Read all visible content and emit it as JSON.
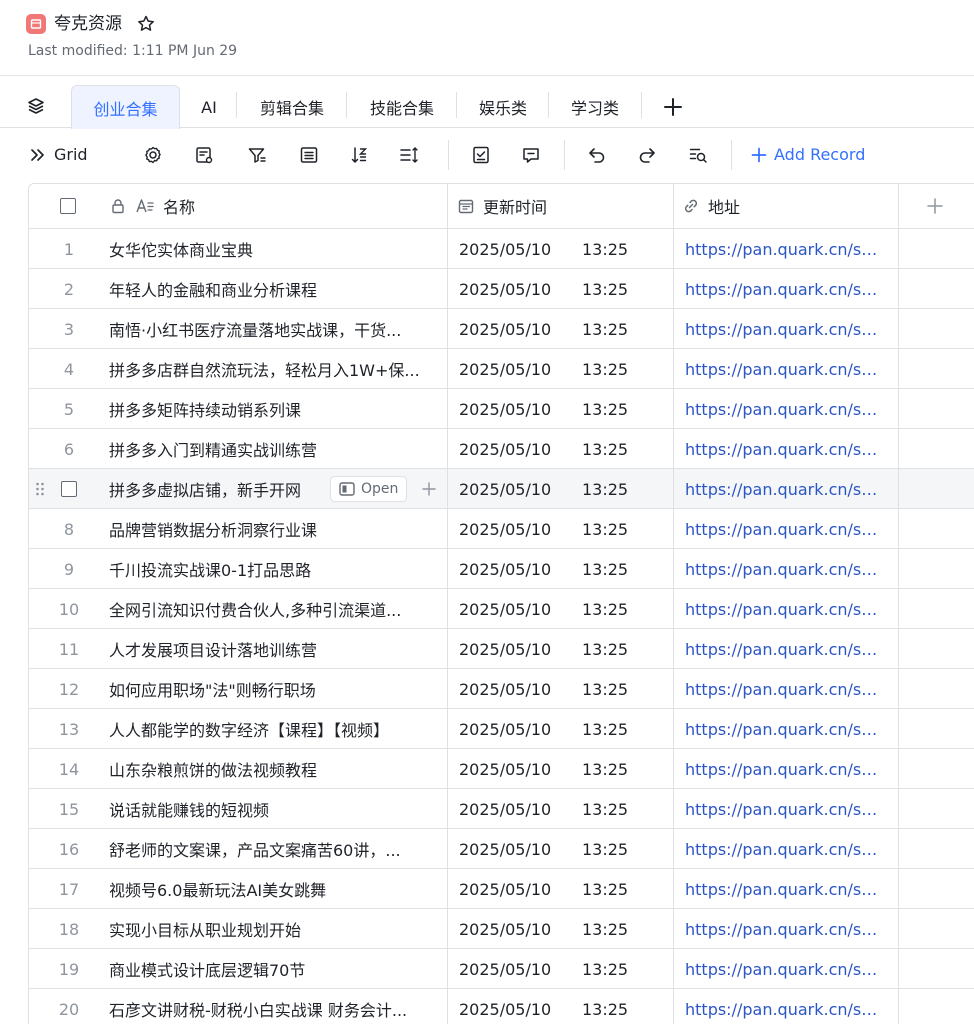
{
  "header": {
    "title": "夸克资源",
    "last_modified": "Last modified: 1:11 PM Jun 29",
    "accent": "#f07777"
  },
  "tabs": [
    {
      "label": "创业合集",
      "active": true
    },
    {
      "label": "AI"
    },
    {
      "label": "剪辑合集"
    },
    {
      "label": "技能合集"
    },
    {
      "label": "娱乐类"
    },
    {
      "label": "学习类"
    }
  ],
  "toolbar": {
    "view_label": "Grid",
    "add_record": "Add Record",
    "icons": [
      "settings-icon",
      "field-config-icon",
      "filter-icon",
      "group-icon",
      "sort-icon",
      "row-height-icon",
      "checklist-icon",
      "comment-icon",
      "undo-icon",
      "redo-icon",
      "search-icon"
    ]
  },
  "table": {
    "columns": {
      "name": "名称",
      "updated": "更新时间",
      "address": "地址"
    },
    "hover_row": {
      "open_label": "Open"
    },
    "rows": [
      {
        "num": "1",
        "name": "女华佗实体商业宝典",
        "date": "2025/05/10",
        "time": "13:25",
        "url": "https://pan.quark.cn/s/..."
      },
      {
        "num": "2",
        "name": "年轻人的金融和商业分析课程",
        "date": "2025/05/10",
        "time": "13:25",
        "url": "https://pan.quark.cn/s/..."
      },
      {
        "num": "3",
        "name": "南悟·小红书医疗流量落地实战课，干货...",
        "date": "2025/05/10",
        "time": "13:25",
        "url": "https://pan.quark.cn/s/..."
      },
      {
        "num": "4",
        "name": "拼多多店群自然流玩法，轻松月入1W+保...",
        "date": "2025/05/10",
        "time": "13:25",
        "url": "https://pan.quark.cn/s/..."
      },
      {
        "num": "5",
        "name": "拼多多矩阵持续动销系列课",
        "date": "2025/05/10",
        "time": "13:25",
        "url": "https://pan.quark.cn/s/..."
      },
      {
        "num": "6",
        "name": "拼多多入门到精通实战训练营",
        "date": "2025/05/10",
        "time": "13:25",
        "url": "https://pan.quark.cn/s/..."
      },
      {
        "num": "7",
        "name": "拼多多虚拟店铺，新手开网",
        "date": "2025/05/10",
        "time": "13:25",
        "url": "https://pan.quark.cn/s/..."
      },
      {
        "num": "8",
        "name": "品牌营销数据分析洞察行业课",
        "date": "2025/05/10",
        "time": "13:25",
        "url": "https://pan.quark.cn/s/..."
      },
      {
        "num": "9",
        "name": "千川投流实战课0-1打品思路",
        "date": "2025/05/10",
        "time": "13:25",
        "url": "https://pan.quark.cn/s/..."
      },
      {
        "num": "10",
        "name": "全网引流知识付费合伙人,多种引流渠道...",
        "date": "2025/05/10",
        "time": "13:25",
        "url": "https://pan.quark.cn/s/..."
      },
      {
        "num": "11",
        "name": "人才发展项目设计落地训练营",
        "date": "2025/05/10",
        "time": "13:25",
        "url": "https://pan.quark.cn/s/..."
      },
      {
        "num": "12",
        "name": "如何应用职场\"法\"则畅行职场",
        "date": "2025/05/10",
        "time": "13:25",
        "url": "https://pan.quark.cn/s/..."
      },
      {
        "num": "13",
        "name": "人人都能学的数字经济【课程】【视频】",
        "date": "2025/05/10",
        "time": "13:25",
        "url": "https://pan.quark.cn/s/..."
      },
      {
        "num": "14",
        "name": "山东杂粮煎饼的做法视频教程",
        "date": "2025/05/10",
        "time": "13:25",
        "url": "https://pan.quark.cn/s/..."
      },
      {
        "num": "15",
        "name": "说话就能赚钱的短视频",
        "date": "2025/05/10",
        "time": "13:25",
        "url": "https://pan.quark.cn/s/..."
      },
      {
        "num": "16",
        "name": "舒老师的文案课，产品文案痛苦60讲，...",
        "date": "2025/05/10",
        "time": "13:25",
        "url": "https://pan.quark.cn/s/..."
      },
      {
        "num": "17",
        "name": "视频号6.0最新玩法AI美女跳舞",
        "date": "2025/05/10",
        "time": "13:25",
        "url": "https://pan.quark.cn/s/..."
      },
      {
        "num": "18",
        "name": "实现小目标从职业规划开始",
        "date": "2025/05/10",
        "time": "13:25",
        "url": "https://pan.quark.cn/s/..."
      },
      {
        "num": "19",
        "name": "商业模式设计底层逻辑70节",
        "date": "2025/05/10",
        "time": "13:25",
        "url": "https://pan.quark.cn/s/..."
      },
      {
        "num": "20",
        "name": "石彦文讲财税-财税小白实战课 财务会计...",
        "date": "2025/05/10",
        "time": "13:25",
        "url": "https://pan.quark.cn/s/..."
      }
    ]
  },
  "colors": {
    "link": "#2a55c4",
    "accent": "#3370ff",
    "border": "#dee0e3"
  }
}
